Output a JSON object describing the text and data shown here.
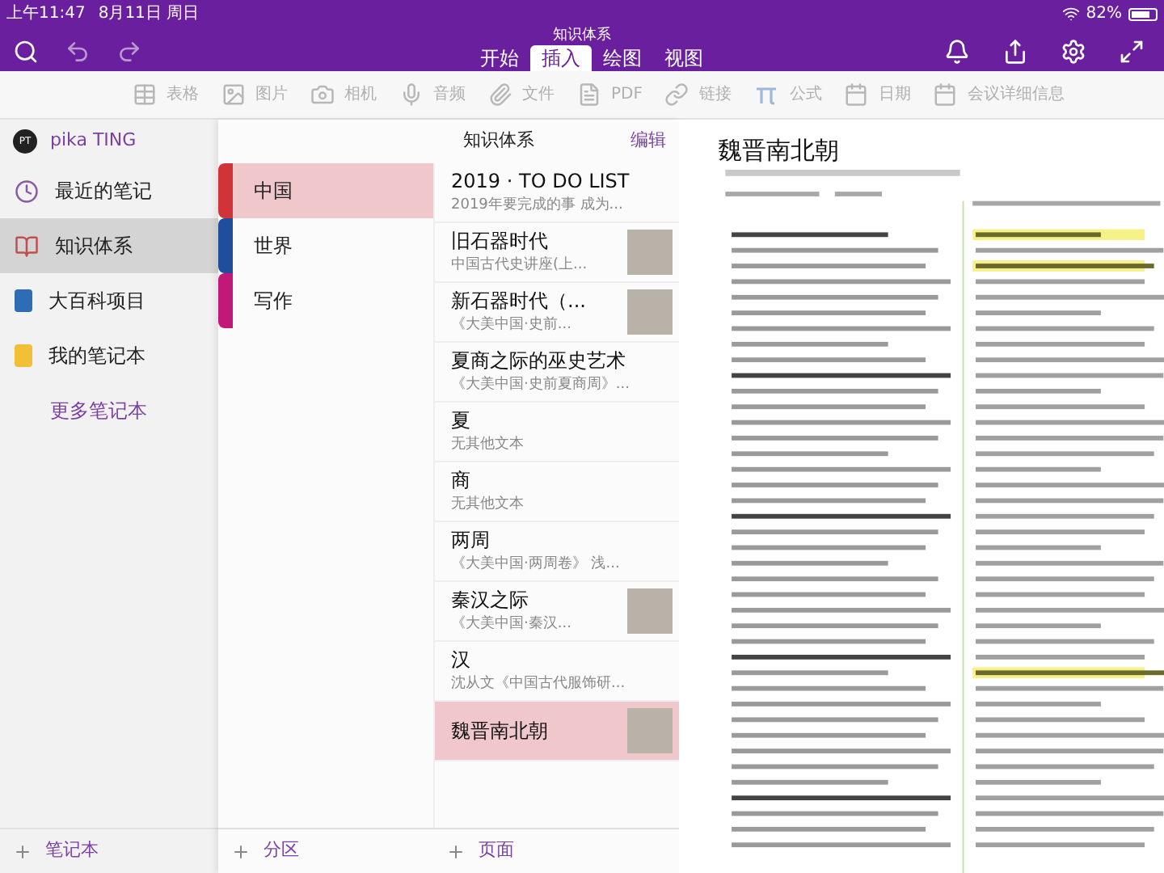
{
  "status_bar": {
    "time": "上午11:47",
    "date": "8月11日 周日",
    "battery": "82%"
  },
  "window": {
    "title": "知识体系"
  },
  "tabs": [
    {
      "label": "开始",
      "selected": false
    },
    {
      "label": "插入",
      "selected": true
    },
    {
      "label": "绘图",
      "selected": false
    },
    {
      "label": "视图",
      "selected": false
    }
  ],
  "toolbar": [
    {
      "kind": "table",
      "label": "表格"
    },
    {
      "kind": "image",
      "label": "图片"
    },
    {
      "kind": "camera",
      "label": "相机"
    },
    {
      "kind": "mic",
      "label": "音频"
    },
    {
      "kind": "clip",
      "label": "文件"
    },
    {
      "kind": "pdf",
      "label": "PDF"
    },
    {
      "kind": "link",
      "label": "链接"
    },
    {
      "kind": "pi",
      "label": "公式"
    },
    {
      "kind": "calendar",
      "label": "日期"
    },
    {
      "kind": "calendar",
      "label": "会议详细信息"
    }
  ],
  "account": {
    "initials": "PT",
    "name": "pika TING"
  },
  "notebooks": [
    {
      "kind": "clock",
      "label": "最近的笔记",
      "selected": false
    },
    {
      "kind": "book",
      "label": "知识体系",
      "selected": true,
      "color": "#c0504d"
    },
    {
      "kind": "notebook",
      "label": "大百科项目",
      "selected": false,
      "color": "#2e6cb5"
    },
    {
      "kind": "notebook",
      "label": "我的笔记本",
      "selected": false,
      "color": "#f2c037"
    }
  ],
  "more_notebooks": "更多笔记本",
  "add_notebook": "笔记本",
  "sections_header": "知识体系",
  "edit": "编辑",
  "sections": [
    {
      "label": "中国",
      "color": "#d13438",
      "selected": true
    },
    {
      "label": "世界",
      "color": "#1e4e9c",
      "selected": false
    },
    {
      "label": "写作",
      "color": "#c2187a",
      "selected": false
    }
  ],
  "add_section": "分区",
  "pages": [
    {
      "title": "2019 · TO DO LIST",
      "preview": "2019年要完成的事  成为...",
      "thumbnail": false,
      "selected": false
    },
    {
      "title": "旧石器时代",
      "preview": "中国古代史讲座(上...",
      "thumbnail": true,
      "selected": false
    },
    {
      "title": "新石器时代（...",
      "preview": "《大美中国·史前...",
      "thumbnail": true,
      "selected": false
    },
    {
      "title": "夏商之际的巫史艺术",
      "preview": "《大美中国·史前夏商周》...",
      "thumbnail": false,
      "selected": false
    },
    {
      "title": "夏",
      "preview": "无其他文本",
      "thumbnail": false,
      "selected": false
    },
    {
      "title": "商",
      "preview": "无其他文本",
      "thumbnail": false,
      "selected": false
    },
    {
      "title": "两周",
      "preview": "《大美中国·两周卷》 浅...",
      "thumbnail": false,
      "selected": false
    },
    {
      "title": "秦汉之际",
      "preview": "《大美中国·秦汉...",
      "thumbnail": true,
      "selected": false
    },
    {
      "title": "汉",
      "preview": "沈从文《中国古代服饰研...",
      "thumbnail": false,
      "selected": false
    },
    {
      "title": "魏晋南北朝",
      "thumbnail": true,
      "selected": true
    }
  ],
  "add_page": "页面",
  "note": {
    "title": "魏晋南北朝"
  }
}
